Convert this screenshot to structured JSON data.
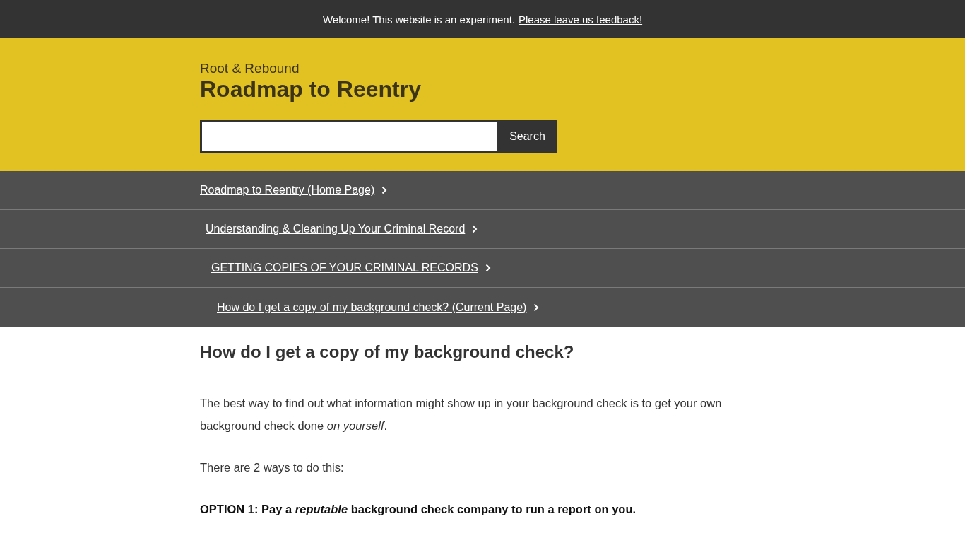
{
  "notice": {
    "text": "Welcome! This website is an experiment.",
    "link": "Please leave us feedback!"
  },
  "header": {
    "org": "Root & Rebound",
    "title": "Roadmap to Reentry",
    "search": {
      "button": "Search"
    }
  },
  "breadcrumbs": [
    {
      "label": "Roadmap to Reentry (Home Page)",
      "children": [
        {
          "label": "Understanding & Cleaning Up Your Criminal Record",
          "children": [
            {
              "label": "GETTING COPIES OF YOUR CRIMINAL RECORDS",
              "children": [
                {
                  "label": "How do I get a copy of my background check? (Current Page)"
                }
              ]
            }
          ]
        }
      ]
    }
  ],
  "article": {
    "heading": "How do I get a copy of my background check?",
    "paragraphs": [
      {
        "kind": "plain",
        "text": "The best way to find out what information might show up in your background check is to get your own background check done *on yourself*."
      },
      {
        "kind": "plain",
        "text": "There are 2 ways to do this:"
      },
      {
        "kind": "strong",
        "text": "OPTION 1: Pay a *reputable* background check company to run a report on you."
      }
    ]
  }
}
